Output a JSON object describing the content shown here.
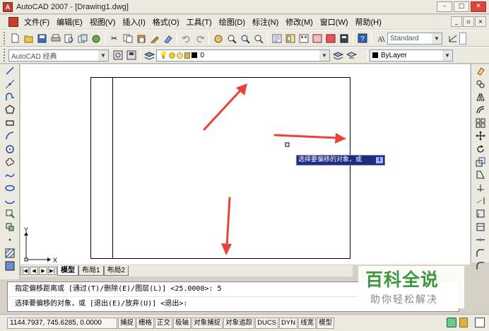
{
  "window": {
    "title": "AutoCAD 2007 - [Drawing1.dwg]",
    "min": "–",
    "max": "□",
    "close": "✕"
  },
  "menu": {
    "items": [
      "文件(F)",
      "编辑(E)",
      "视图(V)",
      "插入(I)",
      "格式(O)",
      "工具(T)",
      "绘图(D)",
      "标注(N)",
      "修改(M)",
      "窗口(W)",
      "帮助(H)"
    ],
    "mdi": [
      "_",
      "▫",
      "×"
    ]
  },
  "toolbar": {
    "textstyle": "Standard",
    "workspace": "AutoCAD 经典",
    "layer": "0",
    "color": "ByLayer"
  },
  "tooltip": {
    "text": "选择要偏移的对象，或",
    "btn": "⬇"
  },
  "ucs": {
    "x": "X",
    "y": "Y"
  },
  "layout_tabs": {
    "nav": [
      "|◀",
      "◀",
      "▶",
      "▶|"
    ],
    "tabs": [
      "模型",
      "布局1",
      "布局2"
    ]
  },
  "command": {
    "line1": "指定偏移距离或 [通过(T)/删除(E)/图层(L)] <25.0000>:  5",
    "line2": "选择要偏移的对象，或 [退出(E)/放弃(U)] <退出>:"
  },
  "status": {
    "coords": "1144.7937, 745.6285, 0.0000",
    "buttons": [
      "捕捉",
      "栅格",
      "正交",
      "极轴",
      "对象捕捉",
      "对象追踪",
      "DUCS",
      "DYN",
      "线宽",
      "模型"
    ]
  },
  "watermark": {
    "title": "百科全说",
    "subtitle": "助你轻松解决"
  },
  "colors": {
    "arrow": "#e8423a",
    "tooltip_bg": "#1f2a80",
    "watermark_green": "#3a9a3a"
  }
}
